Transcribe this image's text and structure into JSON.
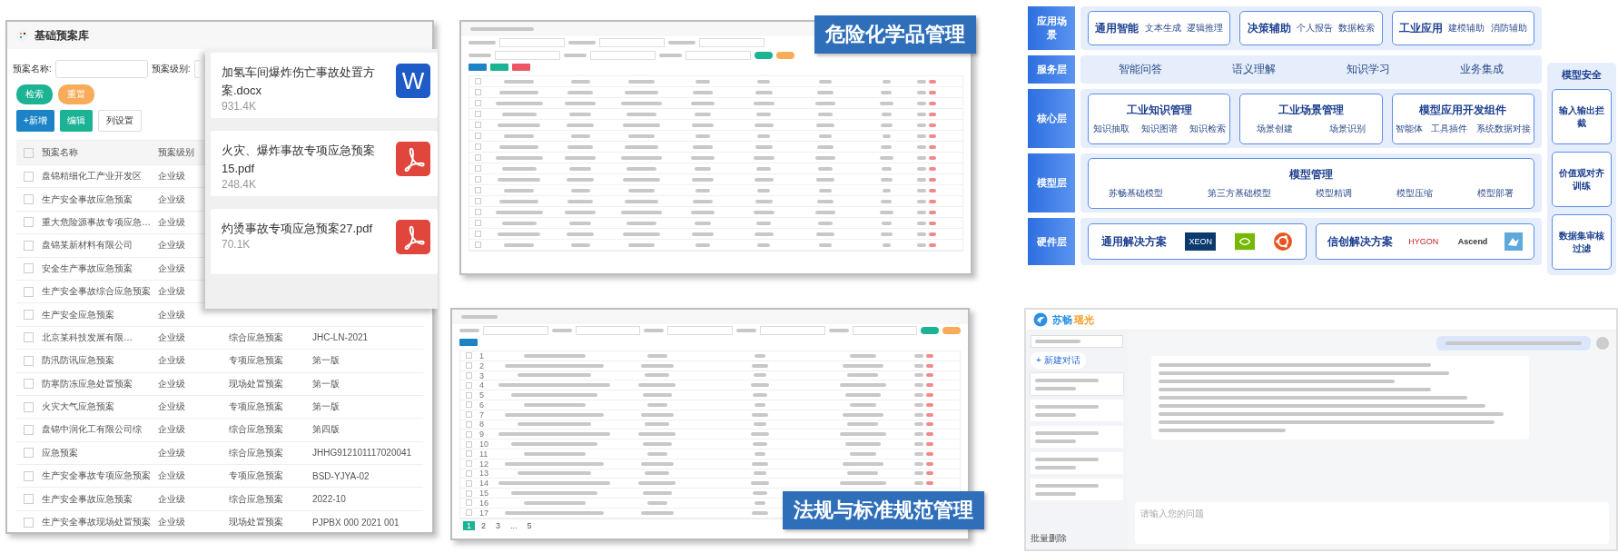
{
  "plan_library": {
    "title": "基础预案库",
    "filters": [
      "预案名称:",
      "预案级别:"
    ],
    "search_buttons": [
      {
        "label": "检索",
        "kind": "search"
      },
      {
        "label": "重置",
        "kind": "reset"
      }
    ],
    "toolbar": [
      {
        "label": "+新增",
        "kind": "add"
      },
      {
        "label": "编辑",
        "kind": "edit"
      },
      {
        "label": "列设置",
        "kind": "settings"
      }
    ],
    "columns": [
      "预案名称",
      "预案级别"
    ],
    "all_checked": false,
    "rows": [
      {
        "checked": false,
        "cells": [
          "盘锦精细化工产业开发区",
          "企业级"
        ]
      },
      {
        "checked": false,
        "cells": [
          "生产安全事故应急预案",
          "企业级"
        ]
      },
      {
        "checked": false,
        "cells": [
          "重大危险源事故专项应急…",
          "企业级"
        ]
      },
      {
        "checked": false,
        "cells": [
          "盘锦某新材料有限公司",
          "企业级"
        ]
      },
      {
        "checked": false,
        "cells": [
          "安全生产事故应急预案",
          "企业级"
        ]
      },
      {
        "checked": false,
        "cells": [
          "生产安全事故综合应急预案",
          "企业级"
        ]
      },
      {
        "checked": false,
        "cells": [
          "生产安全应急预案",
          "企业级"
        ]
      },
      {
        "checked": false,
        "cells": [
          "北京某科技发展有限…",
          "企业级",
          "综合应急预案",
          "JHC-LN-2021"
        ]
      },
      {
        "checked": false,
        "cells": [
          "防汛防讯应急预案",
          "企业级",
          "专项应急预案",
          "第一版"
        ]
      },
      {
        "checked": false,
        "cells": [
          "防寒防冻应急处置预案",
          "企业级",
          "现场处置预案",
          "第一版"
        ]
      },
      {
        "checked": false,
        "cells": [
          "火灾大气应急预案",
          "企业级",
          "专项应急预案",
          "第一版"
        ]
      },
      {
        "checked": false,
        "cells": [
          "盘锦中润化工有限公司综",
          "企业级",
          "综合应急预案",
          "第四版"
        ]
      },
      {
        "checked": false,
        "cells": [
          "应急预案",
          "企业级",
          "综合应急预案",
          "JHHG912101117020041"
        ]
      },
      {
        "checked": false,
        "cells": [
          "生产安全事故专项应急预案",
          "企业级",
          "专项应急预案",
          "BSD-YJYA-02"
        ]
      },
      {
        "checked": false,
        "cells": [
          "生产安全事故应急预案",
          "企业级",
          "综合应急预案",
          "2022-10"
        ]
      },
      {
        "checked": false,
        "cells": [
          "生产安全事故现场处置预案",
          "企业级",
          "现场处置预案",
          "PJPBX 000 2021 001"
        ]
      }
    ]
  },
  "attachments": [
    {
      "name": "加氢车间爆炸伤亡事故处置方案.docx",
      "size": "931.4K",
      "kind": "word",
      "icon_letter": "W"
    },
    {
      "name": "火灾、爆炸事故专项应急预案15.pdf",
      "size": "248.4K",
      "kind": "pdf"
    },
    {
      "name": "灼烫事故专项应急预案27.pdf",
      "size": "70.1K",
      "kind": "pdf"
    }
  ],
  "chemicals": {
    "banner": "危险化学品管理",
    "rows": [
      {
        "checked": false
      },
      {
        "checked": false
      },
      {
        "checked": false
      },
      {
        "checked": false
      },
      {
        "checked": false
      },
      {
        "checked": false
      },
      {
        "checked": false
      },
      {
        "checked": false
      },
      {
        "checked": false
      },
      {
        "checked": false
      },
      {
        "checked": false
      },
      {
        "checked": false
      },
      {
        "checked": false
      },
      {
        "checked": false
      },
      {
        "checked": false
      },
      {
        "checked": false
      }
    ]
  },
  "regulations": {
    "banner": "法规与标准规范管理",
    "rows": [
      {
        "number": "1",
        "checked": false
      },
      {
        "number": "2",
        "checked": false
      },
      {
        "number": "3",
        "checked": false
      },
      {
        "number": "4",
        "checked": false
      },
      {
        "number": "5",
        "checked": false
      },
      {
        "number": "6",
        "checked": false
      },
      {
        "number": "7",
        "checked": false
      },
      {
        "number": "8",
        "checked": false
      },
      {
        "number": "9",
        "checked": false
      },
      {
        "number": "10",
        "checked": false
      },
      {
        "number": "11",
        "checked": false
      },
      {
        "number": "12",
        "checked": false
      },
      {
        "number": "13",
        "checked": false
      },
      {
        "number": "14",
        "checked": false
      },
      {
        "number": "15",
        "checked": false
      },
      {
        "number": "16",
        "checked": false
      },
      {
        "number": "17",
        "checked": false
      }
    ],
    "pages": [
      {
        "label": "1",
        "selected": true
      },
      {
        "label": "2",
        "selected": false
      },
      {
        "label": "3",
        "selected": false
      },
      {
        "label": "...",
        "selected": false
      },
      {
        "label": "5",
        "selected": false
      }
    ]
  },
  "architecture": {
    "layers": [
      {
        "label": "应用场景",
        "kind": "groups",
        "groups": [
          {
            "title": "通用智能",
            "items": [
              "文本生成",
              "逻辑推理"
            ]
          },
          {
            "title": "决策辅助",
            "items": [
              "个人报告",
              "数据检索"
            ]
          },
          {
            "title": "工业应用",
            "items": [
              "建模辅助",
              "消防辅助"
            ]
          }
        ]
      },
      {
        "label": "服务层",
        "kind": "plain",
        "items": [
          "智能问答",
          "语义理解",
          "知识学习",
          "业务集成"
        ]
      },
      {
        "label": "核心层",
        "kind": "cards",
        "groups": [
          {
            "title": "工业知识管理",
            "items": [
              "知识抽取",
              "知识图谱",
              "知识检索"
            ]
          },
          {
            "title": "工业场景管理",
            "items": [
              "场景创建",
              "场景识别"
            ]
          },
          {
            "title": "模型应用开发组件",
            "items": [
              "智能体",
              "工具插件",
              "系统数据对接"
            ]
          }
        ]
      },
      {
        "label": "模型层",
        "kind": "cards",
        "groups": [
          {
            "title": "模型管理",
            "items": [
              "苏畅基础模型",
              "第三方基础模型",
              "模型精调",
              "模型压缩",
              "模型部署"
            ]
          }
        ]
      },
      {
        "label": "硬件层",
        "kind": "hardware",
        "groups": [
          {
            "title": "通用解决方案",
            "logos": [
              {
                "kind": "xeon",
                "text": "XEON"
              },
              {
                "kind": "gpu"
              },
              {
                "kind": "ubuntu"
              }
            ]
          },
          {
            "title": "信创解决方案",
            "logos": [
              {
                "kind": "hygon",
                "text": "HYGON"
              },
              {
                "kind": "ascend",
                "text": "Ascend"
              },
              {
                "kind": "bird"
              }
            ]
          }
        ]
      }
    ],
    "security": {
      "title": "模型安全",
      "items": [
        "输入输出拦截",
        "价值观对齐训练",
        "数据集审核过滤"
      ]
    }
  },
  "chat": {
    "brand": [
      "苏畅",
      "瑶光"
    ],
    "new_chat": "+ 新建对话",
    "input_placeholder": "请输入您的问题",
    "batch_delete": "批量删除"
  }
}
